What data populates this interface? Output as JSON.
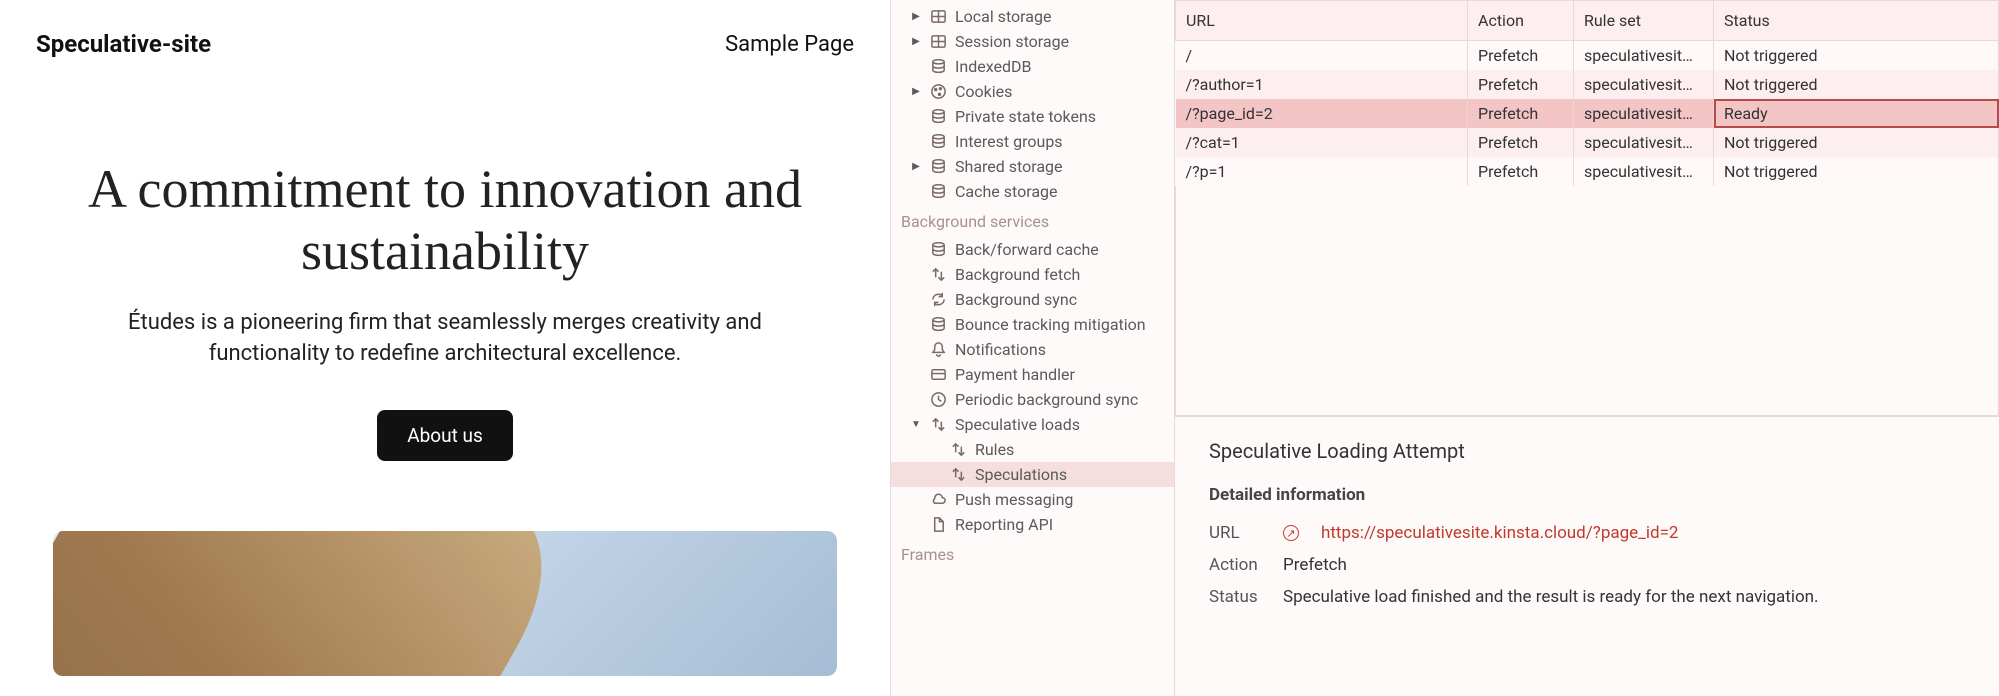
{
  "site": {
    "brand": "Speculative-site",
    "nav": "Sample Page",
    "hero_title": "A commitment to innovation and sustainability",
    "hero_sub": "Études is a pioneering firm that seamlessly merges creativity and functionality to redefine architectural excellence.",
    "hero_btn": "About us"
  },
  "tree": {
    "storage": [
      {
        "label": "Local storage",
        "icon": "grid",
        "caret": true
      },
      {
        "label": "Session storage",
        "icon": "grid",
        "caret": true
      },
      {
        "label": "IndexedDB",
        "icon": "db"
      },
      {
        "label": "Cookies",
        "icon": "cookie",
        "caret": true
      },
      {
        "label": "Private state tokens",
        "icon": "db"
      },
      {
        "label": "Interest groups",
        "icon": "db"
      },
      {
        "label": "Shared storage",
        "icon": "db",
        "caret": true
      },
      {
        "label": "Cache storage",
        "icon": "db"
      }
    ],
    "bg_title": "Background services",
    "bg": [
      {
        "label": "Back/forward cache",
        "icon": "db"
      },
      {
        "label": "Background fetch",
        "icon": "transfer"
      },
      {
        "label": "Background sync",
        "icon": "sync"
      },
      {
        "label": "Bounce tracking mitigation",
        "icon": "db"
      },
      {
        "label": "Notifications",
        "icon": "bell"
      },
      {
        "label": "Payment handler",
        "icon": "card"
      },
      {
        "label": "Periodic background sync",
        "icon": "clock"
      },
      {
        "label": "Speculative loads",
        "icon": "transfer",
        "caret": true,
        "expanded": true,
        "children": [
          {
            "label": "Rules",
            "icon": "transfer"
          },
          {
            "label": "Speculations",
            "icon": "transfer",
            "selected": true
          }
        ]
      },
      {
        "label": "Push messaging",
        "icon": "cloud"
      },
      {
        "label": "Reporting API",
        "icon": "doc"
      }
    ],
    "frames_title": "Frames"
  },
  "table": {
    "headers": [
      "URL",
      "Action",
      "Rule set",
      "Status"
    ],
    "rows": [
      {
        "url": "/",
        "action": "Prefetch",
        "ruleset": "speculativesit…",
        "status": "Not triggered"
      },
      {
        "url": "/?author=1",
        "action": "Prefetch",
        "ruleset": "speculativesit…",
        "status": "Not triggered"
      },
      {
        "url": "/?page_id=2",
        "action": "Prefetch",
        "ruleset": "speculativesit…",
        "status": "Ready",
        "ready": true
      },
      {
        "url": "/?cat=1",
        "action": "Prefetch",
        "ruleset": "speculativesit…",
        "status": "Not triggered"
      },
      {
        "url": "/?p=1",
        "action": "Prefetch",
        "ruleset": "speculativesit…",
        "status": "Not triggered"
      }
    ]
  },
  "detail": {
    "title": "Speculative Loading Attempt",
    "sub": "Detailed information",
    "url_label": "URL",
    "url": "https://speculativesite.kinsta.cloud/?page_id=2",
    "action_label": "Action",
    "action": "Prefetch",
    "status_label": "Status",
    "status": "Speculative load finished and the result is ready for the next navigation."
  }
}
